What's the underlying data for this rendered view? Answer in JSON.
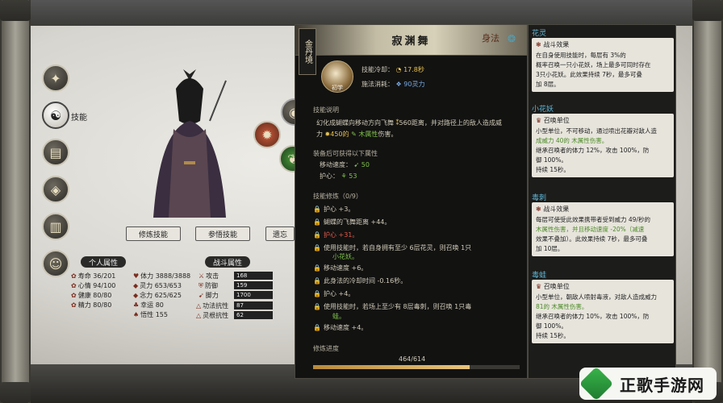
{
  "left": {
    "skill_label": "技能",
    "buttons": [
      "修炼技能",
      "参悟技能",
      "遗忘"
    ],
    "personal_header": "个人属性",
    "combat_header": "战斗属性",
    "personal": [
      {
        "icon": "寿命",
        "val": "36/201"
      },
      {
        "icon": "心情",
        "val": "94/100"
      },
      {
        "icon": "健康",
        "val": "80/80"
      },
      {
        "icon": "精力",
        "val": "80/80"
      }
    ],
    "personal2": [
      {
        "icon": "体力",
        "val": "3888/3888"
      },
      {
        "icon": "灵力",
        "val": "653/653"
      },
      {
        "icon": "念力",
        "val": "625/625"
      },
      {
        "icon": "幸运",
        "val": "80"
      },
      {
        "icon": "悟性",
        "val": "155"
      }
    ],
    "combat": [
      {
        "label": "攻击",
        "val": "168"
      },
      {
        "label": "防御",
        "val": "159"
      },
      {
        "label": "脚力",
        "val": "1700"
      }
    ],
    "combat2": [
      {
        "label": "功法抗性",
        "val": "87"
      },
      {
        "label": "灵根抗性",
        "val": "62"
      }
    ]
  },
  "skill": {
    "realm": "金丹境",
    "title": "寂渊舞",
    "type": "身法",
    "icon_label": "初学",
    "cooldown_label": "技能冷却：",
    "cooldown_val": "17.8秒",
    "cost_label": "施法消耗：",
    "cost_val": "90灵力",
    "desc_header": "技能说明",
    "desc1a": "幻化成蝴蝶向移动方向飞舞",
    "desc1b": "560距离，并对路径上的敌人造成威",
    "desc2a": "力",
    "desc2b": "450的",
    "desc2c": "木属性",
    "desc2d": "伤害。",
    "equip_header": "装备后可获得以下属性",
    "equip1_label": "移动速度：",
    "equip1_val": "50",
    "equip2_label": "护心：",
    "equip2_val": "53",
    "train_header": "技能修炼（0/9）",
    "trains": [
      {
        "text": "护心 +3。"
      },
      {
        "text": "蝴蝶的飞舞距离 +44。"
      },
      {
        "text": "护心 +31。"
      },
      {
        "text": "使用技能时，若自身拥有至少 6层花灵，则召唤 1只"
      },
      {
        "text": "小花妖。"
      },
      {
        "text": "移动速度 +6。"
      },
      {
        "text": "此身法的冷却时间 -0.16秒。"
      },
      {
        "text": "护心 +4。"
      },
      {
        "text": "使用技能时，若场上至少有 8层毒刺，则召唤 1只毒"
      },
      {
        "text": "蛙。"
      },
      {
        "text": "移动速度 +4。"
      }
    ],
    "progress_header": "修炼进度",
    "progress_val": "464/614",
    "progress_frac": 0.756
  },
  "right": {
    "cards": [
      {
        "name": "花灵",
        "sub": "战斗效果",
        "lines": [
          "在自身使用技能时，每层有 3%的",
          "概率召唤一只小花妖，场上最多可同时存在",
          "3只小花妖。此效果持续 7秒，最多可叠",
          "加 8层。"
        ]
      },
      {
        "name": "小花妖",
        "sub": "召唤单位",
        "lines": [
          "小型单位，不可移动，通过喷出花瓣对敌人造",
          "成威力 40的 木属性伤害。",
          "继承召唤者的体力 12%，攻击 100%，防",
          "御 100%。",
          "持续 15秒。"
        ]
      },
      {
        "name": "毒刺",
        "sub": "战斗效果",
        "lines": [
          "每层可使受此效果携带者受到威力 49/秒的",
          "木属性伤害，并且移动速度 -20%（减速",
          "效果不叠加）。此效果持续 7秒，最多可叠",
          "加 10层。"
        ]
      },
      {
        "name": "毒蛙",
        "sub": "召唤单位",
        "lines": [
          "小型单位，朝敌人喷射毒液，对敌人造成威力",
          "81的 木属性伤害。",
          "继承召唤者的体力 10%，攻击 100%，防",
          "御 100%。",
          "持续 15秒。"
        ]
      }
    ]
  },
  "watermark": "正歌手游网"
}
